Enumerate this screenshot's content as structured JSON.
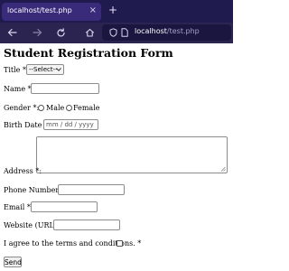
{
  "browser": {
    "tab_title": "localhost/test.php",
    "tab_close": "×",
    "new_tab": "+",
    "url_host": "localhost",
    "url_path": "/test.php",
    "icons": [
      "back-arrow-icon",
      "forward-arrow-icon",
      "reload-icon",
      "home-icon",
      "shield-icon",
      "page-icon"
    ]
  },
  "form": {
    "heading": "Student Registration Form",
    "title_label": "Title *:",
    "title_selected": "--Select--",
    "name_label": "Name *:",
    "gender_label": "Gender *:",
    "gender_male": "Male",
    "gender_female": "Female",
    "birth_label": "Birth Date *:",
    "birth_placeholder": "mm / dd / yyyy",
    "address_label": "Address *:",
    "phone_label": "Phone Number *:",
    "email_label": "Email *:",
    "website_label": "Website (URL):",
    "terms_label": "I agree to the terms and conditions. *",
    "send_label": "Send"
  },
  "colors": {
    "tabbar_bg": "#1f1b4f",
    "navbar_bg": "#2c2450",
    "active_tab_bg": "#3a2a7a"
  }
}
